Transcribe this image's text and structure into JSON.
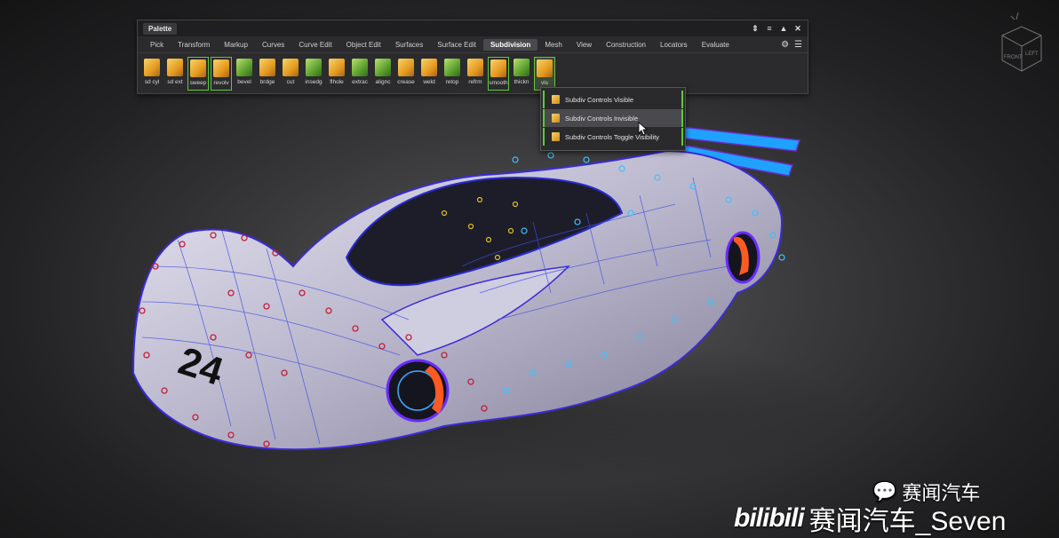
{
  "palette": {
    "title": "Palette",
    "tabs": [
      "Pick",
      "Transform",
      "Markup",
      "Curves",
      "Curve Edit",
      "Object Edit",
      "Surfaces",
      "Surface Edit",
      "Subdivision",
      "Mesh",
      "View",
      "Construction",
      "Locators",
      "Evaluate"
    ],
    "active_tab": "Subdivision",
    "tools": [
      {
        "label": "sd cyl",
        "icon": "cylinder-icon",
        "green": false,
        "state": ""
      },
      {
        "label": "sd ext",
        "icon": "extrude-icon",
        "green": false,
        "state": ""
      },
      {
        "label": "sweep",
        "icon": "sweep-icon",
        "green": false,
        "state": "hl"
      },
      {
        "label": "revolv",
        "icon": "revolve-icon",
        "green": false,
        "state": "hl"
      },
      {
        "label": "bevel",
        "icon": "bevel-icon",
        "green": true,
        "state": ""
      },
      {
        "label": "brdge",
        "icon": "bridge-icon",
        "green": false,
        "state": ""
      },
      {
        "label": "cut",
        "icon": "cut-icon",
        "green": false,
        "state": ""
      },
      {
        "label": "insedg",
        "icon": "insert-edge-icon",
        "green": true,
        "state": ""
      },
      {
        "label": "flhole",
        "icon": "fill-hole-icon",
        "green": false,
        "state": ""
      },
      {
        "label": "extrac",
        "icon": "extract-icon",
        "green": true,
        "state": ""
      },
      {
        "label": "alignc",
        "icon": "align-icon",
        "green": true,
        "state": ""
      },
      {
        "label": "crease",
        "icon": "crease-icon",
        "green": false,
        "state": ""
      },
      {
        "label": "weld",
        "icon": "weld-icon",
        "green": false,
        "state": ""
      },
      {
        "label": "retop",
        "icon": "retopo-icon",
        "green": true,
        "state": ""
      },
      {
        "label": "refrm",
        "icon": "reform-icon",
        "green": false,
        "state": ""
      },
      {
        "label": "smooth",
        "icon": "smooth-icon",
        "green": false,
        "state": "hl"
      },
      {
        "label": "thickn",
        "icon": "thicken-icon",
        "green": true,
        "state": ""
      },
      {
        "label": "vis",
        "icon": "visibility-icon",
        "green": false,
        "state": "sel"
      }
    ]
  },
  "menu": {
    "items": [
      {
        "label": "Subdiv Controls Visible",
        "hover": false
      },
      {
        "label": "Subdiv Controls Invisible",
        "hover": true
      },
      {
        "label": "Subdiv Controls Toggle Visibility",
        "hover": false
      }
    ]
  },
  "car": {
    "race_number": "24"
  },
  "viewcube": {
    "front": "FRONT",
    "left": "LEFT"
  },
  "watermark": {
    "channel": "赛闻汽车",
    "brand": "bilibili",
    "account": "赛闻汽车_Seven"
  }
}
